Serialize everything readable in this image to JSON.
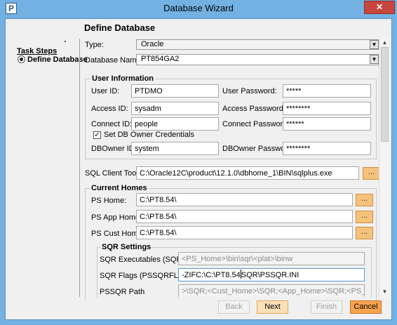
{
  "window": {
    "title": "Database Wizard",
    "app_icon_text": "P",
    "close_label": "✕"
  },
  "page": {
    "heading": "Define Database"
  },
  "task_steps": {
    "title": "Task Steps",
    "items": [
      {
        "label": "Define Database",
        "selected": true
      }
    ]
  },
  "form": {
    "type_label": "Type:",
    "type_value": "Oracle",
    "dbname_label": "Database Name:",
    "dbname_value": "PT854GA2",
    "user_info": {
      "title": "User Information",
      "user_id_label": "User ID:",
      "user_id": "PTDMO",
      "user_password_label": "User Password:",
      "user_password": "*****",
      "access_id_label": "Access ID:",
      "access_id": "sysadm",
      "access_password_label": "Access Password:",
      "access_password": "********",
      "connect_id_label": "Connect ID:",
      "connect_id": "people",
      "connect_password_label": "Connect Password:",
      "connect_password": "******",
      "set_owner_label": "Set DB Owner Credentials",
      "set_owner_checked": true,
      "set_owner_mark": "✓",
      "dbowner_id_label": "DBOwner ID:",
      "dbowner_id": "system",
      "dbowner_password_label": "DBOwner Password:",
      "dbowner_password": "********"
    },
    "sql_client_label": "SQL Client Tool:",
    "sql_client_value": "C:\\Oracle12C\\product\\12.1.0\\dbhome_1\\BIN\\sqlplus.exe",
    "browse_label": "...",
    "current_homes": {
      "title": "Current Homes",
      "ps_home_label": "PS Home:",
      "ps_home": "C:\\PT8.54\\",
      "ps_app_home_label": "PS App Home:",
      "ps_app_home": "C:\\PT8.54\\",
      "ps_cust_home_label": "PS Cust Home:",
      "ps_cust_home": "C:\\PT8.54\\"
    },
    "sqr": {
      "title": "SQR Settings",
      "exec_label": "SQR Executables (SQRBIN)",
      "exec_value": "<PS_Home>\\bin\\sqr\\<plat>\\binw",
      "flags_label": "SQR Flags (PSSQRFLAGS)",
      "flags_value_before_cursor": "-ZIFC:\\C:\\PT8.54",
      "flags_value_after_cursor": "SQR\\PSSQR.INI",
      "path_label": "PSSQR Path",
      "path_value": ">\\SQR;<Cust_Home>\\SQR;<App_Home>\\SQR;<PS_Home>\\SQR"
    }
  },
  "scrollbar": {
    "up_icon": "▲",
    "down_icon": "▼"
  },
  "combo_arrow_icon": "▼",
  "buttons": {
    "back": "Back",
    "next": "Next",
    "finish": "Finish",
    "cancel": "Cancel"
  },
  "colors": {
    "window_frame": "#72b1e2",
    "close_button": "#c7463d",
    "browse_button": "#f5c27c",
    "cancel_button": "#f8a34e"
  }
}
